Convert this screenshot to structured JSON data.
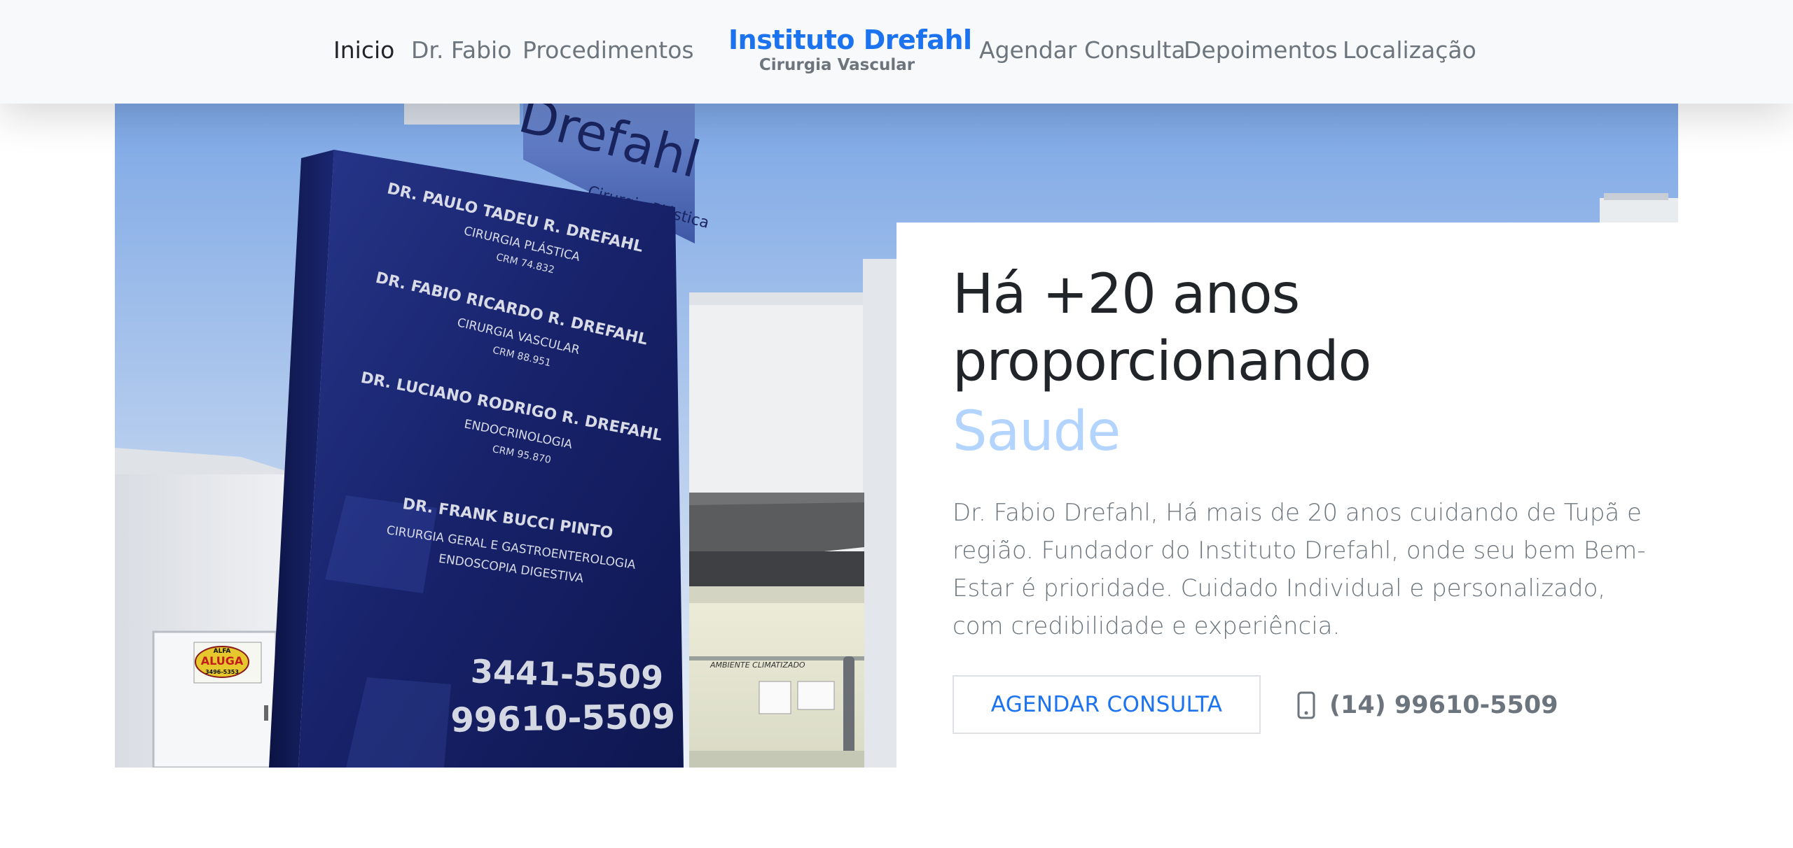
{
  "nav": {
    "items": [
      {
        "label": "Inicio",
        "active": true
      },
      {
        "label": "Dr. Fabio",
        "active": false
      },
      {
        "label": "Procedimentos",
        "active": false
      },
      {
        "label": "Agendar Consulta",
        "active": false
      },
      {
        "label": "Depoimentos",
        "active": false
      },
      {
        "label": "Localização",
        "active": false
      }
    ],
    "brand": {
      "title": "Instituto Drefahl",
      "subtitle": "Cirurgia Vascular"
    }
  },
  "hero": {
    "heading": "Há +20 anos proporcionando",
    "highlight": "Saude",
    "description": "Dr. Fabio Drefahl, Há mais de 20 anos cuidando de Tupã e região. Fundador do Instituto Drefahl, onde seu bem Bem-Estar é prioridade. Cuidado Individual e personalizado, com credibilidade e experiência.",
    "button_label": "AGENDAR CONSULTA",
    "phone": "(14) 99610-5509",
    "phone_icon": "phone-icon"
  },
  "photo": {
    "sign_brand": "Drefahl",
    "sign_brand_sub": "Cirurgia Plástica",
    "doctors": [
      {
        "name": "DR. PAULO TADEU R. DREFAHL",
        "specialty": "CIRURGIA PLÁSTICA",
        "crm": "CRM 74.832"
      },
      {
        "name": "DR. FABIO RICARDO R. DREFAHL",
        "specialty": "CIRURGIA VASCULAR",
        "crm": "CRM 88.951"
      },
      {
        "name": "DR. LUCIANO RODRIGO R. DREFAHL",
        "specialty": "ENDOCRINOLOGIA",
        "crm": "CRM 95.870"
      },
      {
        "name": "DR. FRANK BUCCI PINTO",
        "specialty": "CIRURGIA GERAL E GASTROENTEROLOGIA",
        "crm": "ENDOSCOPIA DIGESTIVA"
      }
    ],
    "phone1": "3441-5509",
    "phone2": "99610-5509",
    "rent_sign_top": "ALFA",
    "rent_sign_main": "ALUGA",
    "rent_sign_phone": "3496-5353",
    "store_sign": "AMBIENTE CLIMATIZADO",
    "colors": {
      "sky_top": "#7da7e4",
      "sky_bottom": "#e8eef6",
      "sign_blue": "#18246a",
      "wall": "#eef0f2"
    }
  },
  "colors": {
    "brand": "#1c73f0",
    "highlight": "#b3d4ff",
    "muted": "#6c757d",
    "dark": "#212529",
    "navbar_bg": "#f8f9fa"
  }
}
